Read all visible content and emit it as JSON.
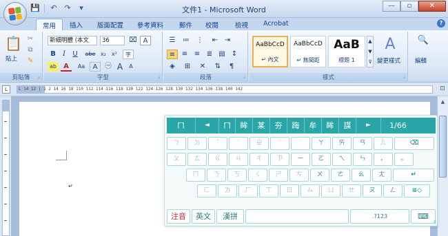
{
  "window": {
    "title": "文件1 - Microsoft Word",
    "min": "—",
    "max": "▫",
    "close": "✕"
  },
  "qat": {
    "save": "💾",
    "undo": "↶",
    "redo": "↷",
    "more": "▾"
  },
  "tabs": [
    {
      "label": "常用",
      "active": true
    },
    {
      "label": "插入"
    },
    {
      "label": "版面配置"
    },
    {
      "label": "參考資料"
    },
    {
      "label": "郵件"
    },
    {
      "label": "校閱"
    },
    {
      "label": "檢視"
    },
    {
      "label": "Acrobat"
    }
  ],
  "help": "?",
  "ribbon": {
    "clipboard": {
      "label": "剪貼簿",
      "paste": "貼上"
    },
    "font": {
      "label": "字型",
      "font_name": "新細明體 (本文",
      "font_size": "36",
      "bold": "B",
      "italic": "I",
      "underline": "U",
      "strike": "abe",
      "sub": "x₂",
      "sup": "x²",
      "change_case": "Aa",
      "grow": "A",
      "shrink": "A"
    },
    "paragraph": {
      "label": "段落"
    },
    "styles": {
      "label": "樣式",
      "cards": [
        {
          "sample": "AaBbCcD",
          "name": "↵ 內文",
          "selected": true
        },
        {
          "sample": "AaBbCcD",
          "name": "↵ 無間距"
        },
        {
          "sample": "AaB",
          "name": "標題 1"
        }
      ],
      "change_styles": "變更樣式"
    },
    "editing": {
      "label": "編輯"
    }
  },
  "ruler": {
    "text": "L   14  12  |  1 2  14  16  18  110  112  114  116  118  120  122  124  126  128  130  132  134  136  138  140  142"
  },
  "ime": {
    "top": [
      "ㄇ",
      "◄",
      "ㄇ",
      "眸",
      "某",
      "夯",
      "踇",
      "牟",
      "眸",
      "謀",
      "►",
      "1/66"
    ],
    "row1": [
      "ㄅ",
      "ㄉ",
      "ˇ",
      "ˋ",
      "ㄓ",
      "ˊ",
      "˙",
      "ㄚ",
      "ㄞ",
      "ㄢ",
      "ㄦ",
      "⌫"
    ],
    "row2": [
      "ㄆ",
      "ㄊ",
      "ㄍ",
      "ㄐ",
      "ㄔ",
      "ㄗ",
      "ㄧ",
      "ㄛ",
      "ㄟ",
      "ㄣ",
      "，",
      "。"
    ],
    "row3": [
      "ㄇ",
      "ㄋ",
      "ㄎ",
      "ㄑ",
      "ㄕ",
      "ㄘ",
      "ㄨ",
      "ㄜ",
      "ㄠ",
      "ㄤ",
      "↵"
    ],
    "row4": [
      "ㄈ",
      "ㄌ",
      "ㄏ",
      "ㄒ",
      "ㄖ",
      "ㄙ",
      "ㄩ",
      "ㄝ",
      "ㄡ",
      "ㄥ",
      "≡◇"
    ],
    "bottom": {
      "zhuyin": "注音",
      "english": "英文",
      "pinyin": "漢拼",
      "space": "",
      "numbers": ".?123",
      "keyboard": "⌨"
    }
  },
  "colors": {
    "ime_accent": "#2aa5a8",
    "office_logo": [
      "#e8542a",
      "#7cb83a",
      "#2a83d6",
      "#f4b21a"
    ]
  }
}
